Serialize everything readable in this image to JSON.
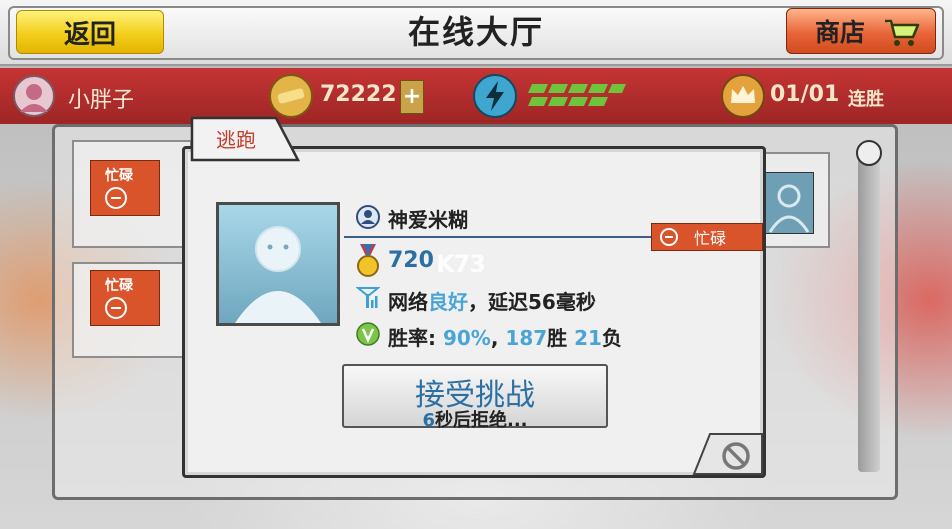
{
  "header": {
    "back_label": "返回",
    "title": "在线大厅",
    "shop_label": "商店"
  },
  "status": {
    "username": "小胖子",
    "coins": "72222",
    "coins_add": "+",
    "streak_value": "01/01",
    "streak_label": "连胜"
  },
  "lobby": {
    "rows": [
      {
        "badge": "忙碌"
      },
      {
        "badge": "忙碌"
      }
    ]
  },
  "dialog": {
    "tab_label": "逃跑",
    "player_name": "神爱米糊",
    "busy_label": "忙碌",
    "score": "720",
    "network_prefix": "网络",
    "network_quality": "良好",
    "network_suffix": "，延迟56毫秒",
    "winrate_label": "胜率:",
    "winrate_value": "90%",
    "wins_value": "187",
    "wins_label": "胜",
    "losses_value": "21",
    "losses_label": "负",
    "accept_label": "接受挑战",
    "countdown_value": "6",
    "countdown_suffix": "秒后拒绝..."
  },
  "watermark": "K73",
  "colors": {
    "back_button": "#f2cf1c",
    "shop_button": "#e8653a",
    "status_bar": "#b52020",
    "busy_tag": "#d9542a",
    "highlight": "#4aa5d6"
  }
}
